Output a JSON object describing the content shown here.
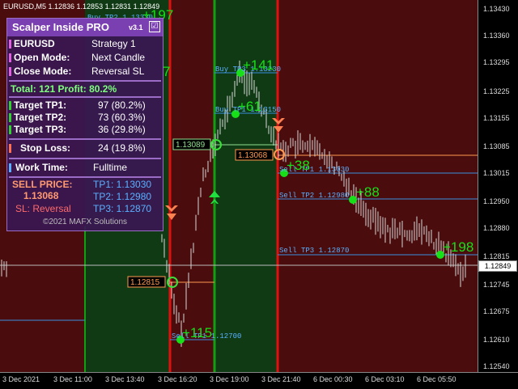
{
  "chart": {
    "title": "EURUSD,M5  1.12836 1.12853 1.12831 1.12849",
    "current_price": "1.12849",
    "price_ticks": [
      "1.13360",
      "1.13225",
      "1.13085",
      "1.12950",
      "1.12815",
      "1.12675",
      "1.12540",
      "1.13295",
      "1.13155",
      "1.13015",
      "1.12880",
      "1.12745",
      "1.12610",
      "1.13430"
    ],
    "time_ticks": [
      "3 Dec 2021",
      "3 Dec 11:00",
      "3 Dec 13:40",
      "3 Dec 16:20",
      "3 Dec 19:00",
      "3 Dec 21:40",
      "6 Dec 00:30",
      "6 Dec 03:10",
      "6 Dec 05:50"
    ],
    "labels": {
      "buy_tp2": "Buy TP2 1.13330",
      "buy_tp3": "Buy TP3 1.13230",
      "buy_tp1": "Buy TP1 1.13150",
      "sell_tp1_a": "Sell TP1 1.12700",
      "sell_tp1_b": "Sell TP1 1.13030",
      "sell_tp2": "Sell TP2 1.12980",
      "sell_tp3": "Sell TP3 1.12870",
      "entry_1": "1.13089",
      "entry_2": "1.13068",
      "entry_3": "1.12815"
    },
    "points": [
      "+197",
      "+141",
      "+61",
      "+38",
      "+88",
      "+198",
      "+115",
      "7"
    ],
    "colors": {
      "bg": "#000000",
      "zone_red": "#4a0c0c",
      "zone_green": "#0f3a14",
      "line_red": "#e01010",
      "line_green": "#12a012",
      "tp_line": "#3a8fe0",
      "entry_line": "#ff9a50",
      "candle": "#d8d8d8",
      "point_green": "#18e018"
    }
  },
  "panel": {
    "title": "Scalper Inside PRO",
    "version": "v3.1",
    "check": "☑",
    "symbol": "EURUSD",
    "strategy": "Strategy 1",
    "open_mode_label": "Open Mode:",
    "open_mode_value": "Next Candle",
    "close_mode_label": "Close Mode:",
    "close_mode_value": "Reversal SL",
    "total": "Total: 121  Profit: 80.2%",
    "target_tp1_label": "Target TP1:",
    "target_tp1_value": "97 (80.2%)",
    "target_tp2_label": "Target TP2:",
    "target_tp2_value": "73 (60.3%)",
    "target_tp3_label": "Target TP3:",
    "target_tp3_value": "36 (29.8%)",
    "stop_loss_label": "Stop Loss:",
    "stop_loss_value": "24 (19.8%)",
    "work_time_label": "Work Time:",
    "work_time_value": "Fulltime",
    "sell_price_label": "SELL PRICE:",
    "sell_price_value": "1.13068",
    "sl_reversal": "SL: Reversal",
    "tp1": "TP1: 1.13030",
    "tp2": "TP2: 1.12980",
    "tp3": "TP3: 1.12870",
    "copyright": "©2021 MAFX Solutions"
  }
}
